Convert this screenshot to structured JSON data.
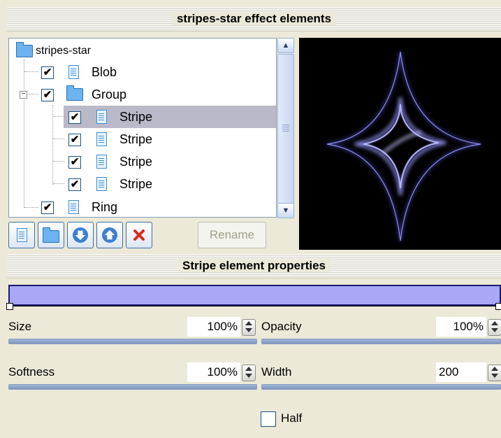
{
  "header_elements": "stripes-star effect elements",
  "header_properties": "Stripe element properties",
  "tree": {
    "root": "stripes-star",
    "items": [
      {
        "label": "Blob",
        "checked": true,
        "icon": "file-icon"
      },
      {
        "label": "Group",
        "checked": true,
        "icon": "folder-icon"
      },
      {
        "label": "Stripe",
        "checked": true,
        "icon": "file-icon",
        "selected": true
      },
      {
        "label": "Stripe",
        "checked": true,
        "icon": "file-icon"
      },
      {
        "label": "Stripe",
        "checked": true,
        "icon": "file-icon"
      },
      {
        "label": "Stripe",
        "checked": true,
        "icon": "file-icon"
      },
      {
        "label": "Ring",
        "checked": true,
        "icon": "file-icon"
      }
    ],
    "checkmark": "✔"
  },
  "toolbar": {
    "new_element_icon": "new-file-icon",
    "new_group_icon": "new-folder-icon",
    "move_down_icon": "arrow-down-icon",
    "move_up_icon": "arrow-up-icon",
    "delete_icon": "delete-icon",
    "rename_label": "Rename"
  },
  "properties": {
    "size_label": "Size",
    "size_value": "100%",
    "opacity_label": "Opacity",
    "opacity_value": "100%",
    "softness_label": "Softness",
    "softness_value": "100%",
    "width_label": "Width",
    "width_value": "200",
    "half_label": "Half",
    "half_checked": false
  },
  "colors": {
    "gradient": "#a8a8f6",
    "preview_bg": "#000000",
    "star": "#8c8cf0"
  }
}
